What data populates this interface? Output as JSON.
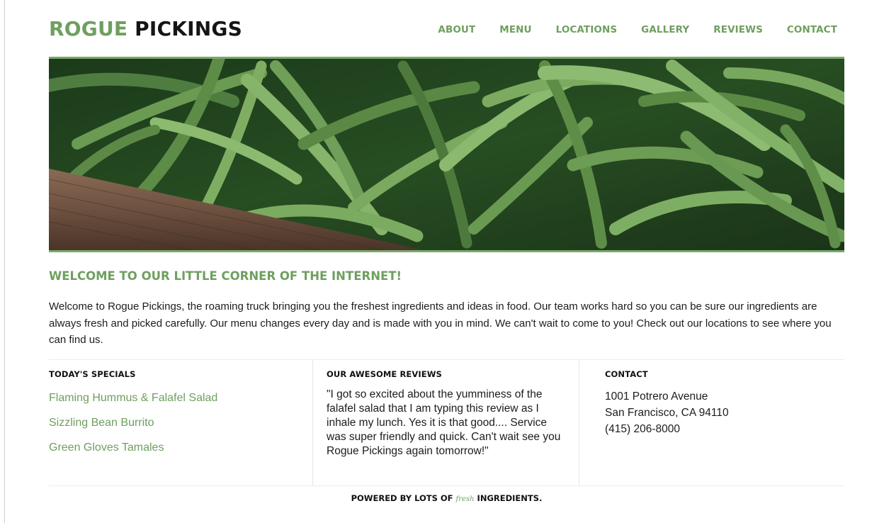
{
  "brand": {
    "word1": "ROGUE",
    "word2": "PICKINGS"
  },
  "nav": [
    {
      "label": "ABOUT"
    },
    {
      "label": "MENU"
    },
    {
      "label": "LOCATIONS"
    },
    {
      "label": "GALLERY"
    },
    {
      "label": "REVIEWS"
    },
    {
      "label": "CONTACT"
    }
  ],
  "welcome": {
    "title": "WELCOME TO OUR LITTLE CORNER OF THE INTERNET!",
    "text": "Welcome to Rogue Pickings, the roaming truck bringing you the freshest ingredients and ideas in food. Our team works hard so you can be sure our ingredients are always fresh and picked carefully. Our menu changes every day and is made with you in mind. We can't wait to come to you! Check out our locations to see where you can find us."
  },
  "specials": {
    "heading": "TODAY'S SPECIALS",
    "items": [
      "Flaming Hummus & Falafel Salad",
      "Sizzling Bean Burrito",
      "Green Gloves Tamales"
    ]
  },
  "reviews": {
    "heading": "OUR AWESOME REVIEWS",
    "text": "\"I got so excited about the yumminess of the falafel salad that I am typing this review as I inhale my lunch. Yes it is that good.... Service was super friendly and quick. Can't wait see you Rogue Pickings again tomorrow!\""
  },
  "contact": {
    "heading": "CONTACT",
    "address1": "1001 Potrero Avenue",
    "address2": "San Francisco, CA 94110",
    "phone": "(415) 206-8000"
  },
  "footer": {
    "prefix": "POWERED BY LOTS OF",
    "fresh": "fresh",
    "suffix": "INGREDIENTS."
  },
  "colors": {
    "accent": "#6f9f5f",
    "text": "#1a1a1a",
    "hero_border": "#7aa86b"
  },
  "hero_image": {
    "subject": "green beans on wooden crate"
  }
}
